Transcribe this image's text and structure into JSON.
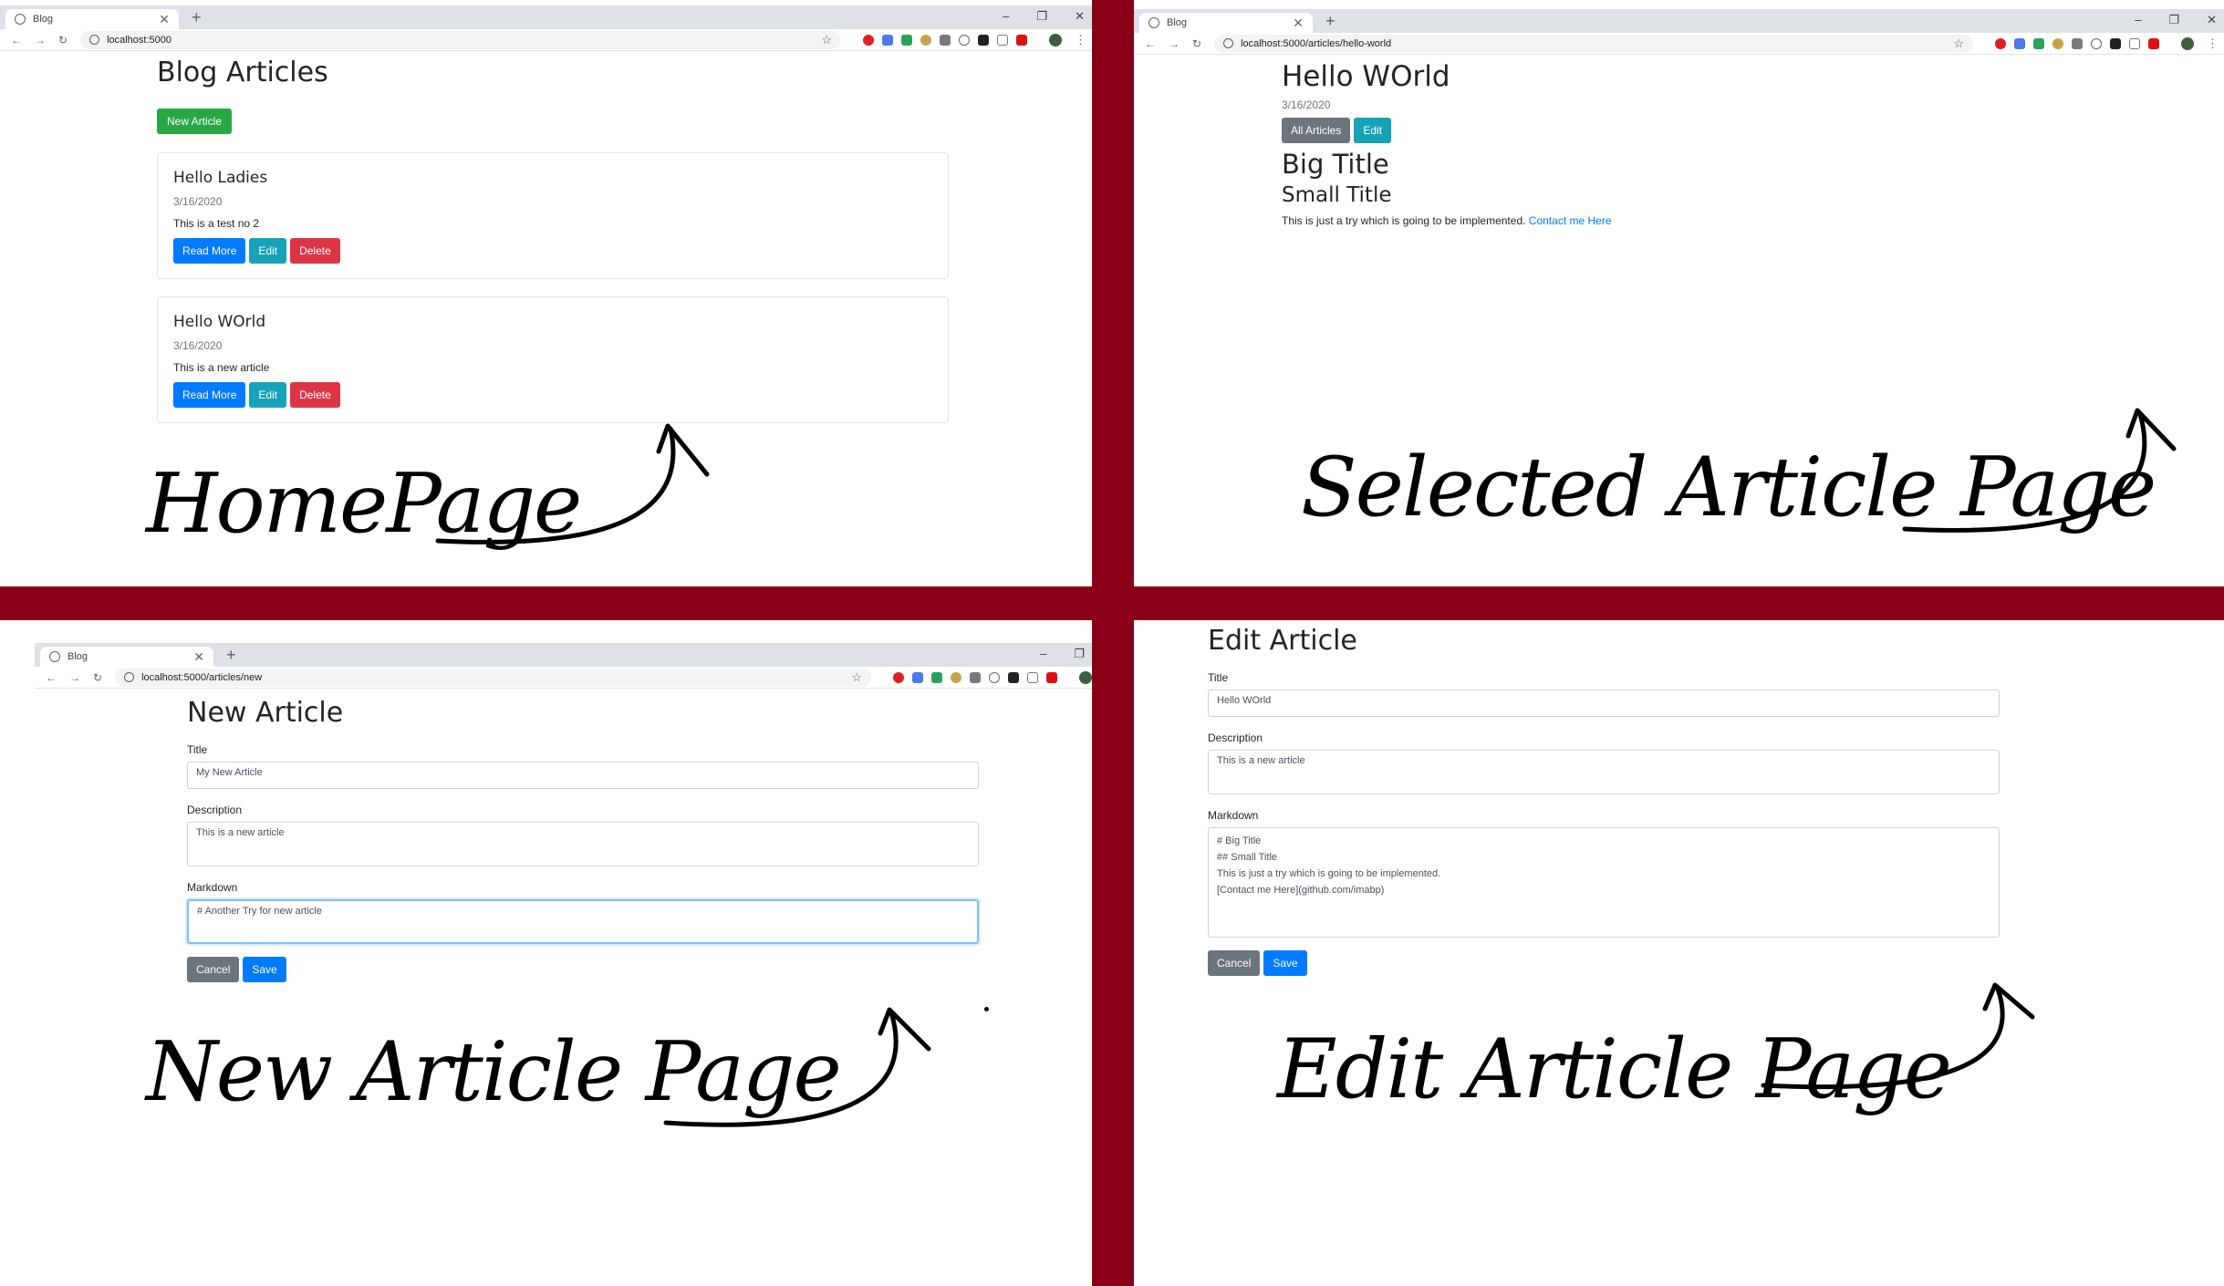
{
  "browser": {
    "tab_title": "Blog",
    "tab_close": "✕",
    "new_tab": "+",
    "minimize": "–",
    "restore": "❐",
    "close": "✕",
    "back": "←",
    "forward": "→",
    "reload": "↻",
    "star": "☆",
    "menu": "⋮"
  },
  "home": {
    "url": "localhost:5000",
    "heading": "Blog Articles",
    "new_article_button": "New Article",
    "articles": [
      {
        "title": "Hello Ladies",
        "date": "3/16/2020",
        "description": "This is a test no 2",
        "read_more": "Read More",
        "edit": "Edit",
        "delete": "Delete"
      },
      {
        "title": "Hello WOrld",
        "date": "3/16/2020",
        "description": "This is a new article",
        "read_more": "Read More",
        "edit": "Edit",
        "delete": "Delete"
      }
    ],
    "caption": "HomePage"
  },
  "selected": {
    "url": "localhost:5000/articles/hello-world",
    "heading": "Hello WOrld",
    "date": "3/16/2020",
    "all_articles_button": "All Articles",
    "edit_button": "Edit",
    "big_title": "Big Title",
    "small_title": "Small Title",
    "body_text": "This is just a try which is going to be implemented.",
    "link_text": "Contact me Here",
    "caption": "Selected Article Page"
  },
  "new_article": {
    "url": "localhost:5000/articles/new",
    "heading": "New Article",
    "title_label": "Title",
    "title_value": "My New Article",
    "description_label": "Description",
    "description_value": "This is a new article",
    "markdown_label": "Markdown",
    "markdown_value": "# Another Try for new article",
    "cancel_button": "Cancel",
    "save_button": "Save",
    "caption": "New Article Page"
  },
  "edit_article": {
    "heading": "Edit Article",
    "title_label": "Title",
    "title_value": "Hello WOrld",
    "description_label": "Description",
    "description_value": "This is a new article",
    "markdown_label": "Markdown",
    "markdown_lines": [
      "# Big Title",
      "## Small Title",
      "This is just a try which is going to be implemented.",
      "[Contact me Here](github.com/imabp)"
    ],
    "cancel_button": "Cancel",
    "save_button": "Save",
    "caption": "Edit Article Page"
  },
  "colors": {
    "divider": "#8a0016",
    "success": "#28a745",
    "primary": "#007bff",
    "info": "#17a2b8",
    "danger": "#dc3545",
    "secondary": "#6c757d"
  }
}
